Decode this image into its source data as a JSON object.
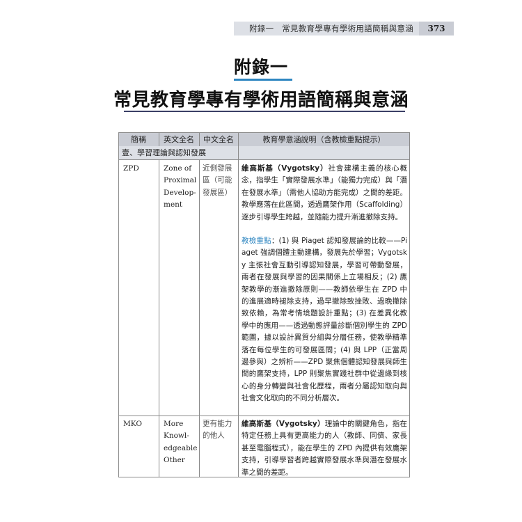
{
  "running_header": {
    "text": "附錄一　常見教育學專有學術用語簡稱與意涵",
    "page_number": "373"
  },
  "appendix_label": "附錄一",
  "chapter_title": "常見教育學專有學術用語簡稱與意涵",
  "table": {
    "headers": [
      "簡稱",
      "英文全名",
      "中文全名",
      "教育學意涵說明（含教檢重點提示）"
    ],
    "section": "壹、學習理論與認知發展",
    "rows": [
      {
        "abbr": "ZPD",
        "english": "Zone of Proximal Develop-ment",
        "english_lines": [
          "Zone of",
          "Proximal",
          "Develop-",
          "ment"
        ],
        "chinese": "近側發展區（可能發展區）",
        "chinese_lines": [
          "近側發展",
          "區（可能",
          "發展區）"
        ],
        "desc_bold": "維高斯基（Vygotsky）",
        "desc_rest": "社會建構主義的核心概念，指學生「實際發展水準」（能獨力完成）與「潛在發展水準」（需他人協助方能完成）之間的差距。教學應落在此區間，透過鷹架作用（Scaffolding）逐步引導學生跨越，並隨能力提升漸進撤除支持。",
        "exam_label": "教檢重點",
        "exam_text": "：(1) 與 Piaget 認知發展論的比較——Piaget 強調個體主動建構，發展先於學習；Vygotsky 主張社會互動引導認知發展，學習可帶動發展，兩者在發展與學習的因果關係上立場相反；(2) 鷹架教學的漸進撤除原則——教師依學生在 ZPD 中的進展適時褪除支持，過早撤除致挫敗、過晚撤除致依賴，為常考情境題設計重點；(3) 在差異化教學中的應用——透過動態評量診斷個別學生的 ZPD 範圍，據以設計異質分組與分層任務，使教學精準落在每位學生的可發展區間；(4) 與 LPP（正當周邊參與）之辨析——ZPD 聚焦個體認知發展與師生間的鷹架支持，LPP 則聚焦實踐社群中從邊緣到核心的身分轉變與社會化歷程，兩者分屬認知取向與社會文化取向的不同分析層次。"
      },
      {
        "abbr": "MKO",
        "english": "More Knowl-edgeable Other",
        "english_lines": [
          "More",
          "Knowl-",
          "edgeable",
          "Other"
        ],
        "chinese": "更有能力的他人",
        "chinese_lines": [
          "更有能力",
          "的他人"
        ],
        "desc_bold": "維高斯基（Vygotsky）",
        "desc_rest": "理論中的關鍵角色，指在特定任務上具有更高能力的人（教師、同儕、家長甚至電腦程式），能在學生的 ZPD 內提供有效鷹架支持，引導學習者跨越實際發展水準與潛在發展水準之間的差距。"
      }
    ]
  }
}
